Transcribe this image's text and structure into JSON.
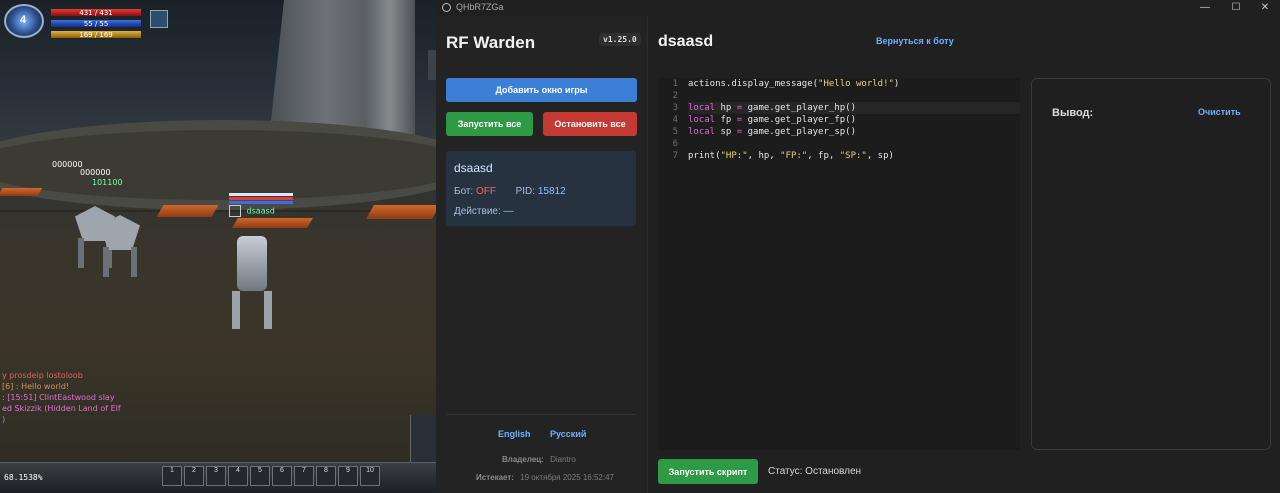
{
  "game": {
    "hud": {
      "level": "4",
      "hp": "431 / 431",
      "fp": "55 / 55",
      "sp": "169 / 169"
    },
    "overhead_tags": [
      "000000",
      "000000",
      "101100"
    ],
    "player_name": "dsaasd",
    "chat_lines": [
      {
        "text": "у prosdeip lostoloob",
        "color": "c1"
      },
      {
        "text": "[6] : Hello world!",
        "color": "c2"
      },
      {
        "text": ": [15:51] ClintEastwood slay",
        "color": "c3"
      },
      {
        "text": "ed Skizzik (Hidden Land of Elf",
        "color": "c3"
      },
      {
        "text": ")",
        "color": "c3"
      }
    ],
    "exp": "68.1538%",
    "hotbar_slots": [
      "1",
      "2",
      "3",
      "4",
      "5",
      "6",
      "7",
      "8",
      "9",
      "10"
    ]
  },
  "window": {
    "title": "QHbR7ZGa",
    "controls": [
      "—",
      "☐",
      "✕"
    ]
  },
  "sidebar": {
    "brand": "RF Warden",
    "version": "v1.25.0",
    "add_window_label": "Добавить окно игры",
    "start_all_label": "Запустить все",
    "stop_all_label": "Остановить все",
    "card": {
      "name": "dsaasd",
      "bot_label": "Бот:",
      "bot_state": "OFF",
      "pid_label": "PID:",
      "pid": "15812",
      "action_label": "Действие:",
      "action_value": "—"
    },
    "languages": [
      "English",
      "Русский"
    ],
    "owner_label": "Владелец:",
    "owner": "Diantro",
    "expires_label": "Истекает:",
    "expires": "19 октября 2025 16:52:47"
  },
  "main": {
    "script_title": "dsaasd",
    "back_link": "Вернуться к боту",
    "output_label": "Вывод:",
    "clear_label": "Очистить",
    "run_label": "Запустить скрипт",
    "status": "Статус: Остановлен",
    "code_lines": [
      "actions.display_message(\"Hello world!\")",
      "",
      "local hp = game.get_player_hp()",
      "local fp = game.get_player_fp()",
      "local sp = game.get_player_sp()",
      "",
      "print(\"HP:\", hp, \"FP:\", fp, \"SP:\", sp)"
    ],
    "highlight_line": 3
  },
  "colors": {
    "accent_blue": "#3c7fd7",
    "success_green": "#2e9a46",
    "danger_red": "#c43a32",
    "link_blue": "#6fb1ff",
    "off_red": "#f06a5e"
  }
}
